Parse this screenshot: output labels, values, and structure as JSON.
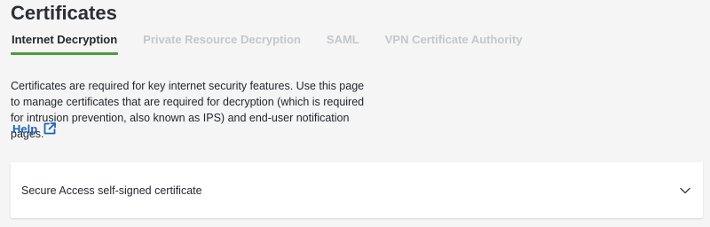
{
  "page": {
    "title": "Certificates"
  },
  "tabs": [
    {
      "label": "Internet Decryption",
      "active": true
    },
    {
      "label": "Private Resource Decryption",
      "active": false
    },
    {
      "label": "SAML",
      "active": false
    },
    {
      "label": "VPN Certificate Authority",
      "active": false
    }
  ],
  "description": {
    "text": "Certificates are required for key internet security features. Use this page to manage certificates that are required for decryption (which is required for intrusion prevention, also known as IPS) and end-user notification pages."
  },
  "help": {
    "label": "Help",
    "icon": "external-link-icon"
  },
  "certificate_card": {
    "title": "Secure Access self-signed certificate",
    "icon": "chevron-down-icon"
  },
  "colors": {
    "accent_green": "#4d9c3c",
    "link_blue": "#1f63b9",
    "inactive_tab": "#c3c7cc",
    "background": "#f5f5f5"
  }
}
